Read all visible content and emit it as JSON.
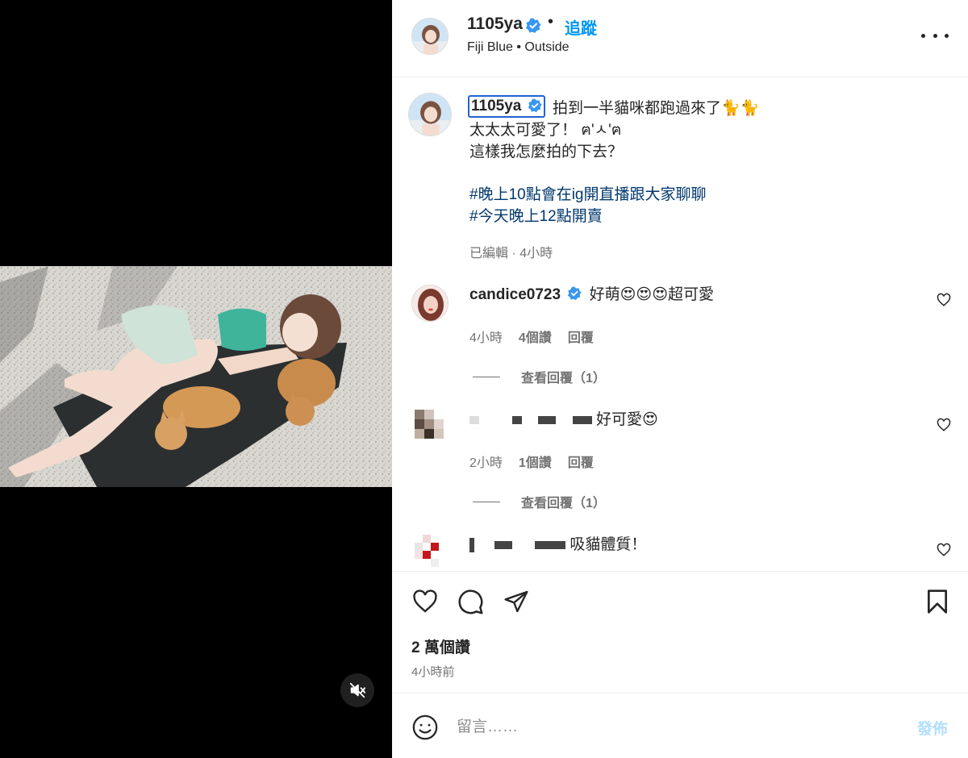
{
  "media": {
    "mute_icon": "volume-muted-icon"
  },
  "header": {
    "username": "1105ya",
    "separator": "•",
    "follow_label": "追蹤",
    "audio": "Fiji Blue • Outside",
    "more_icon": "more-horizontal-icon"
  },
  "caption": {
    "username": "1105ya",
    "line1": "拍到一半貓咪都跑過來了🐈🐈",
    "line2": "太太太可愛了！ ฅ'ㅅ'ฅ",
    "line3": "這樣我怎麼拍的下去？",
    "hashtag1": "#晚上10點會在ig開直播跟大家聊聊",
    "hashtag2": "#今天晚上12點開賣",
    "meta": "已編輯 · 4小時"
  },
  "comments": [
    {
      "username": "candice0723",
      "verified": true,
      "text": "好萌😍😍😍超可愛",
      "time": "4小時",
      "likes": "4個讚",
      "reply_label": "回覆",
      "view_replies": "查看回覆（1）"
    },
    {
      "username": "",
      "verified": false,
      "text": "好可愛😍",
      "time": "2小時",
      "likes": "1個讚",
      "reply_label": "回覆",
      "view_replies": "查看回覆（1）"
    },
    {
      "username": "",
      "verified": false,
      "text": "吸貓體質！"
    }
  ],
  "actions": {
    "likes_count": "2 萬個讚",
    "posted": "4小時前"
  },
  "composer": {
    "placeholder": "留言……",
    "post_label": "發佈"
  },
  "colors": {
    "accent": "#0095f6",
    "verified": "#3897f0",
    "hashtag": "#00376b",
    "muted_text": "#737373",
    "post_disabled": "#b2dffc"
  }
}
